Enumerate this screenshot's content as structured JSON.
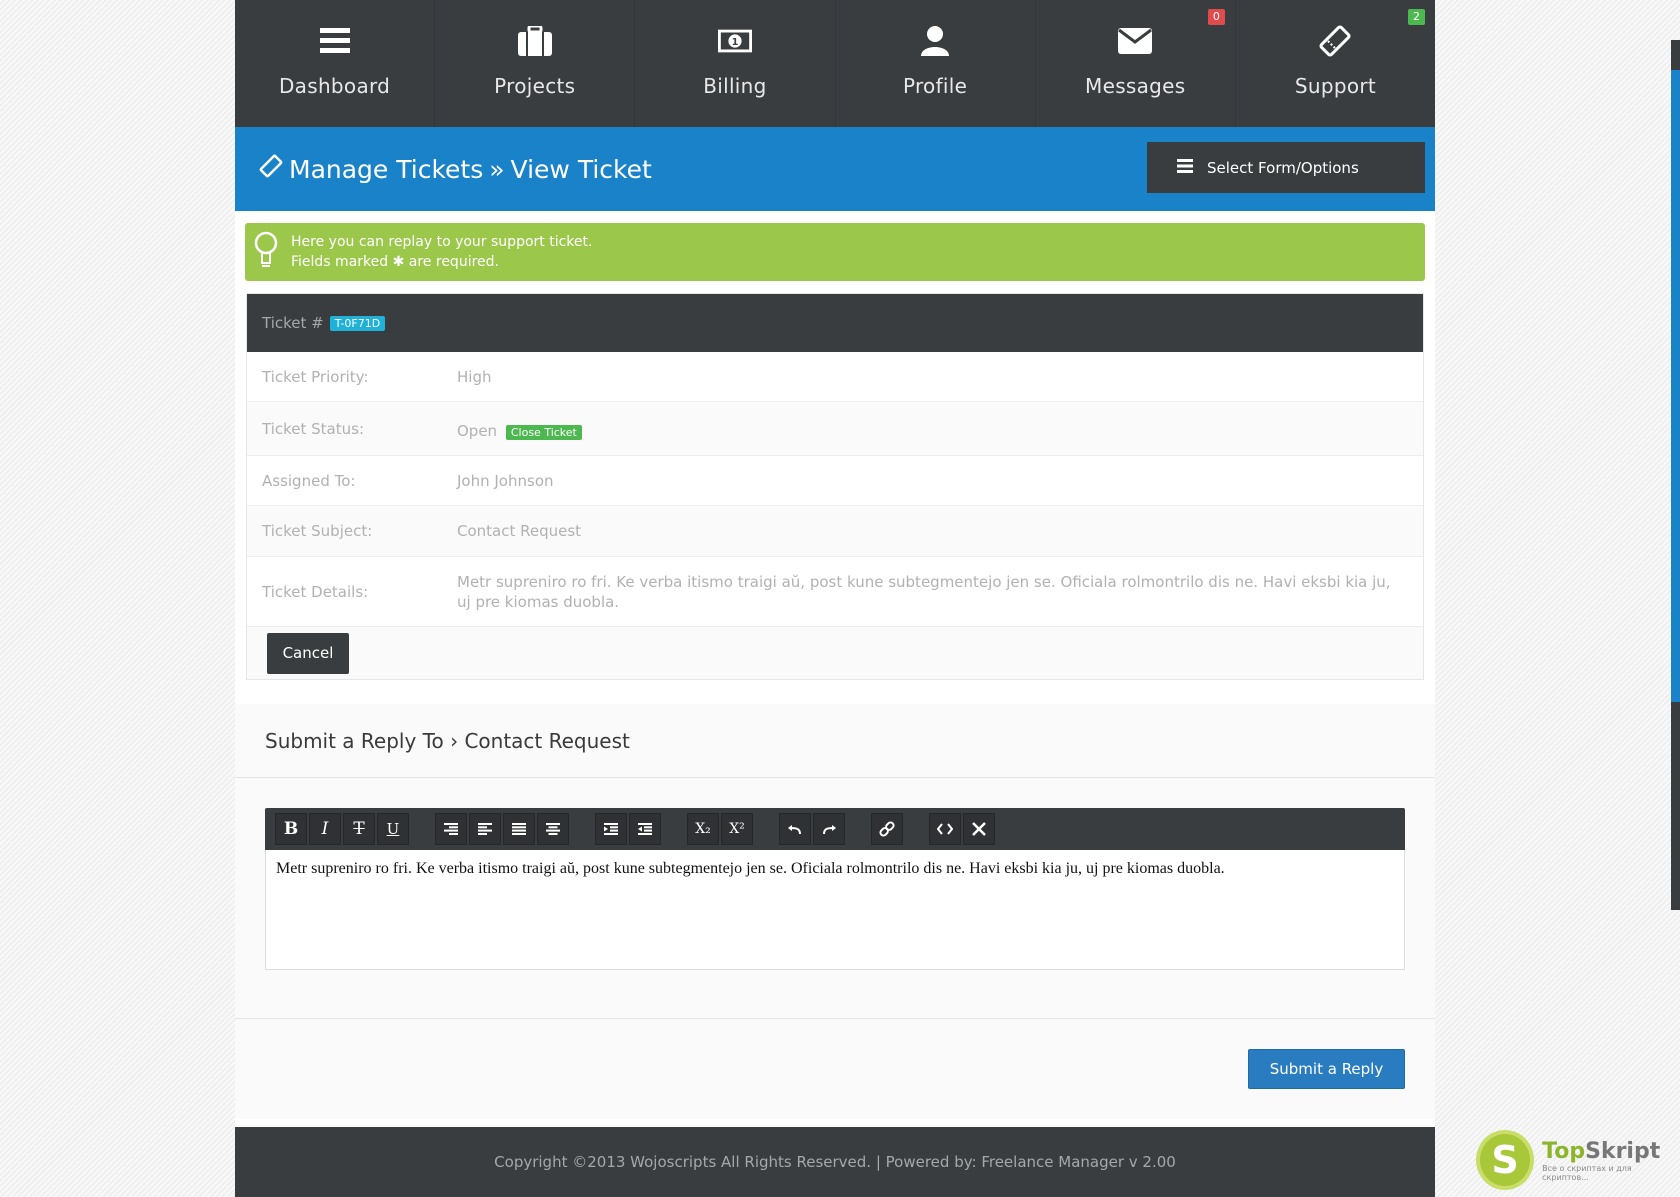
{
  "nav": {
    "items": [
      {
        "label": "Dashboard",
        "icon": "bars-icon"
      },
      {
        "label": "Projects",
        "icon": "briefcase-icon"
      },
      {
        "label": "Billing",
        "icon": "money-icon"
      },
      {
        "label": "Profile",
        "icon": "user-icon"
      },
      {
        "label": "Messages",
        "icon": "envelope-icon",
        "badge": "0",
        "badge_color": "#e14b4b"
      },
      {
        "label": "Support",
        "icon": "ticket-icon",
        "badge": "2",
        "badge_color": "#4cb84f"
      }
    ]
  },
  "header": {
    "title_part1": "Manage Tickets",
    "separator": "»",
    "title_part2": "View Ticket",
    "select_button": "Select Form/Options"
  },
  "alert": {
    "line1": "Here you can replay to your support ticket.",
    "line2_pre": "Fields marked",
    "line2_post": "are required."
  },
  "ticket": {
    "label": "Ticket #",
    "id": "T-0F71D",
    "rows": [
      {
        "label": "Ticket Priority:",
        "value": "High"
      },
      {
        "label": "Ticket Status:",
        "value": "Open",
        "action": "Close Ticket"
      },
      {
        "label": "Assigned To:",
        "value": "John Johnson"
      },
      {
        "label": "Ticket Subject:",
        "value": "Contact Request"
      },
      {
        "label": "Ticket Details:",
        "value": "Metr supreniro ro fri. Ke verba itismo traigi aŭ, post kune subtegmentejo jen se. Oficiala rolmontrilo dis ne. Havi eksbi kia ju, uj pre kiomas duobla."
      }
    ],
    "cancel": "Cancel"
  },
  "reply": {
    "title_pre": "Submit a Reply To",
    "title_sep": "›",
    "title_subject": "Contact Request",
    "editor_content": "Metr supreniro ro fri. Ke verba itismo traigi aŭ, post kune subtegmentejo jen se. Oficiala rolmontrilo dis ne. Havi eksbi kia ju, uj pre kiomas duobla.",
    "submit": "Submit a Reply"
  },
  "toolbar": {
    "bold": "B",
    "italic": "I",
    "strike": "T",
    "underline": "U",
    "subscript": "X₂",
    "superscript": "X²"
  },
  "footer": {
    "text": "Copyright ©2013 Wojoscripts All Rights Reserved. | Powered by: Freelance Manager v 2.00"
  },
  "watermark": {
    "letter": "S",
    "brand_a": "Top",
    "brand_b": "Skript",
    "sub": "Все о скриптах и для скриптов..."
  },
  "colors": {
    "nav_bg": "#3a3d40",
    "header_blue": "#1a82c9",
    "alert_green": "#9bc84a",
    "ticket_id_bg": "#1fb1d8",
    "close_green": "#4cb84f",
    "submit_blue": "#2a7cc1"
  }
}
